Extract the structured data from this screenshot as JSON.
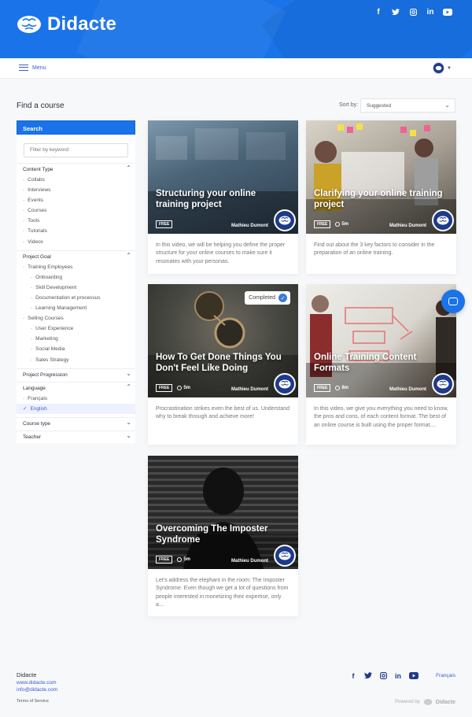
{
  "brand": {
    "name": "Didacte"
  },
  "header": {
    "socials": [
      "facebook-icon",
      "twitter-icon",
      "instagram-icon",
      "linkedin-icon",
      "youtube-icon"
    ]
  },
  "navbar": {
    "menu_label": "Menu"
  },
  "main": {
    "title": "Find a course",
    "sort_label": "Sort by:",
    "sort_value": "Suggested"
  },
  "sidebar": {
    "search_label": "Search",
    "keyword_placeholder": "Filter by keyword",
    "content_type": {
      "title": "Content Type",
      "items": [
        "Collabs",
        "Interviews",
        "Events",
        "Courses",
        "Tools",
        "Tutorials",
        "Videos"
      ]
    },
    "project_goal": {
      "title": "Project Goal",
      "training_employees": "Training Employees",
      "training_items": [
        "Onboarding",
        "Skill Development",
        "Documentation et processus",
        "Learning Management"
      ],
      "selling_courses": "Selling Courses",
      "selling_items": [
        "User Experience",
        "Marketing",
        "Social Media",
        "Sales Strategy"
      ]
    },
    "project_progression": {
      "title": "Project Progression"
    },
    "language": {
      "title": "Language",
      "items": [
        "Français",
        "English"
      ]
    },
    "course_type": {
      "title": "Course type"
    },
    "teacher": {
      "title": "Teacher"
    }
  },
  "cards": [
    {
      "title": "Structuring your online training project",
      "free": "FREE",
      "duration": "",
      "author": "Mathieu Dumont",
      "completed": "",
      "description": "In this video, we will be helping you define the proper structure for your online courses to make sure it resonates with your personas."
    },
    {
      "title": "Clarifying your online training project",
      "free": "FREE",
      "duration": "5m",
      "author": "Mathieu Dumont",
      "completed": "",
      "description": "Find out about the 3 key factors to consider in the preparation of an online training."
    },
    {
      "title": "How To Get Done Things You Don't Feel Like Doing",
      "free": "FREE",
      "duration": "5m",
      "author": "Mathieu Dumont",
      "completed": "Completed",
      "description": "Procrastination strikes even the best of us. Understand why to break through and achieve more!"
    },
    {
      "title": "Online Training Content Formats",
      "free": "FREE",
      "duration": "8m",
      "author": "Mathieu Dumont",
      "completed": "",
      "description": "In this video, we give you everything you need to know, the pros and cons, of each content format. The best of an online course is built using the proper format...."
    },
    {
      "title": "Overcoming The Imposter Syndrome",
      "free": "FREE",
      "duration": "5m",
      "author": "Mathieu Dumont",
      "completed": "",
      "description": "Let's address the elephant in the room: The Imposter Syndrome. Even though we get a lot of questions from people interested in monetizing their expertise, only a..."
    }
  ],
  "footer": {
    "name": "Didacte",
    "website": "www.didacte.com",
    "email": "info@didacte.com",
    "terms": "Terms of Service",
    "language": "Français",
    "powered_by": "Powered by",
    "powered_brand": "Didacte"
  },
  "colors": {
    "primary": "#1a73e8",
    "navy": "#1e3a8a",
    "link": "#3a5bd9"
  }
}
